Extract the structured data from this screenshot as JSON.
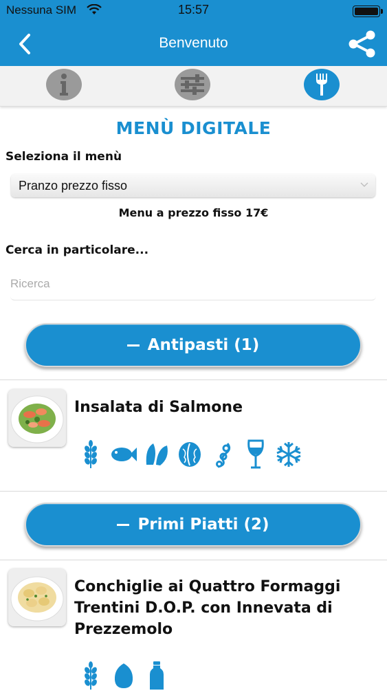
{
  "status_bar": {
    "carrier": "Nessuna SIM",
    "time": "15:57"
  },
  "nav": {
    "title": "Benvenuto"
  },
  "tabs": [
    {
      "name": "info-icon",
      "active": false
    },
    {
      "name": "settings-sliders-icon",
      "active": false
    },
    {
      "name": "fork-icon",
      "active": true
    }
  ],
  "main": {
    "heading": "MENÙ DIGITALE",
    "select_label": "Seleziona il menù",
    "select_value": "Pranzo prezzo fisso",
    "price_text": "Menu a prezzo fisso 17€",
    "search_label": "Cerca in particolare...",
    "search_placeholder": "Ricerca"
  },
  "categories": [
    {
      "label": "Antipasti (1)",
      "dishes": [
        {
          "name": "Insalata di Salmone",
          "icons": [
            "wheat-icon",
            "fish-icon",
            "mollusc-icon",
            "nut-icon",
            "soy-icon",
            "wine-glass-icon",
            "snowflake-icon"
          ]
        }
      ]
    },
    {
      "label": "Primi Piatti (2)",
      "dishes": [
        {
          "name": "Conchiglie ai Quattro Formaggi Trentini D.O.P. con Innevata di Prezzemolo",
          "icons": [
            "wheat-icon",
            "egg-icon",
            "milk-bottle-icon"
          ]
        }
      ]
    }
  ],
  "colors": {
    "accent": "#1a8fd0",
    "inactive_tab": "#9a9a9a"
  }
}
